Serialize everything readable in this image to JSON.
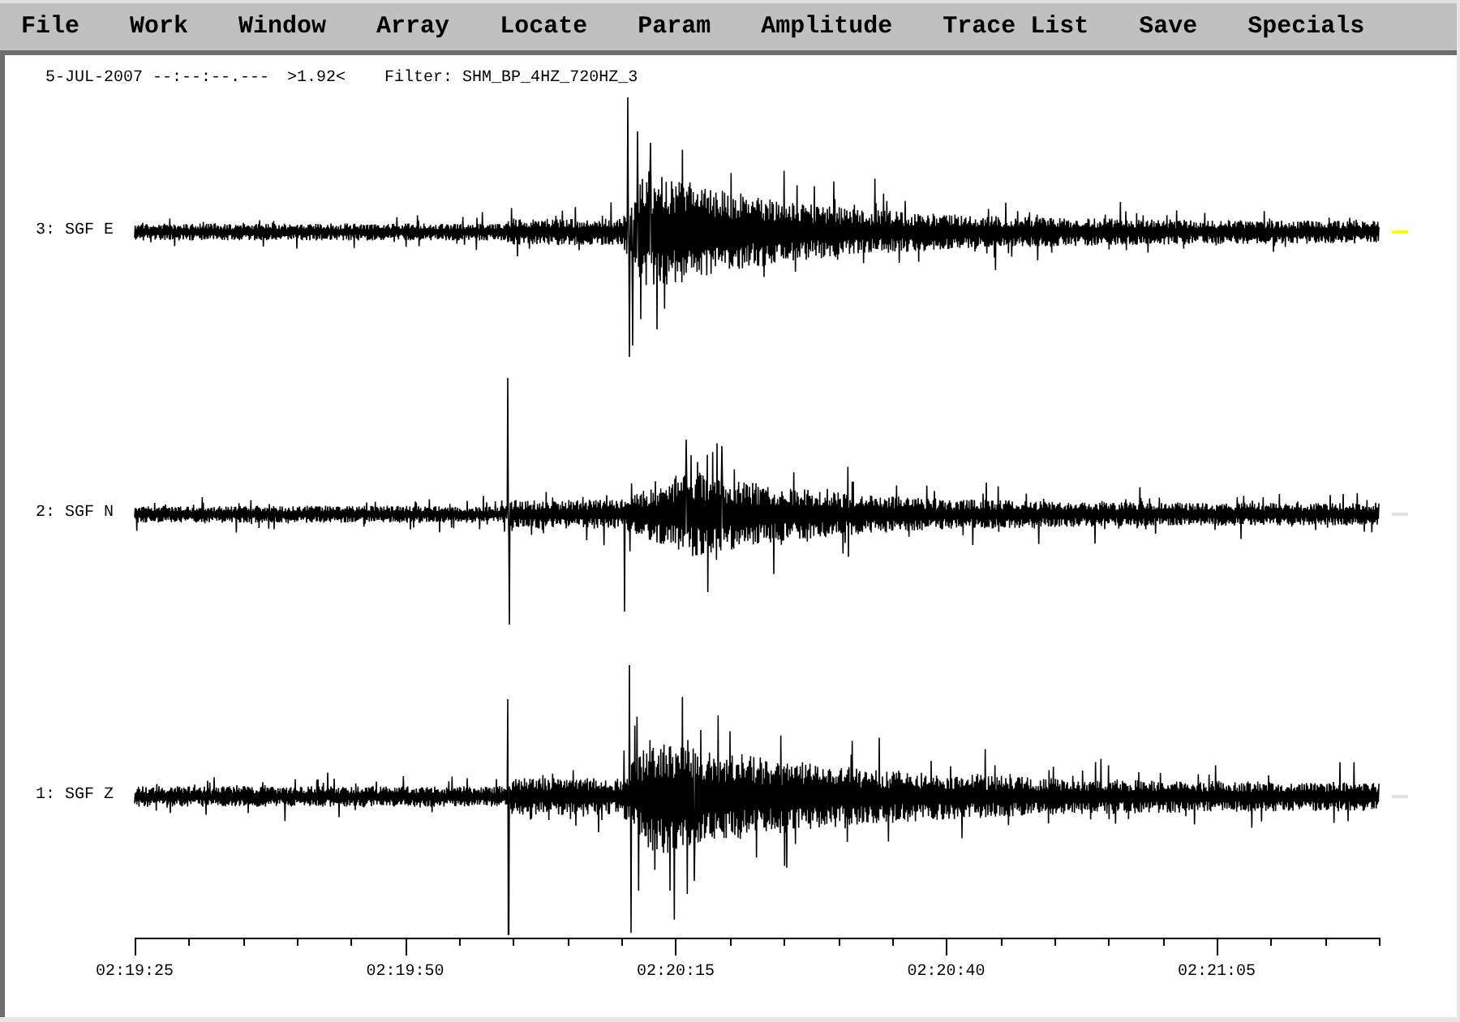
{
  "menu_bar": {
    "items": [
      "File",
      "Work",
      "Window",
      "Array",
      "Locate",
      "Param",
      "Amplitude",
      "Trace List",
      "Save",
      "Specials"
    ]
  },
  "header": {
    "date_time": "5-JUL-2007 --:--:--.---",
    "scale": ">1.92<",
    "filter": "Filter: SHM_BP_4HZ_720HZ_3"
  },
  "traces": [
    {
      "label": "3: SGF E",
      "color": "#ffff00"
    },
    {
      "label": "2: SGF N",
      "color": "#e2e2e2"
    },
    {
      "label": "1: SGF Z",
      "color": "#e2e2e2"
    }
  ],
  "time_axis": {
    "labels": [
      "02:19:25",
      "02:19:50",
      "02:20:15",
      "02:20:40",
      "02:21:05"
    ]
  }
}
